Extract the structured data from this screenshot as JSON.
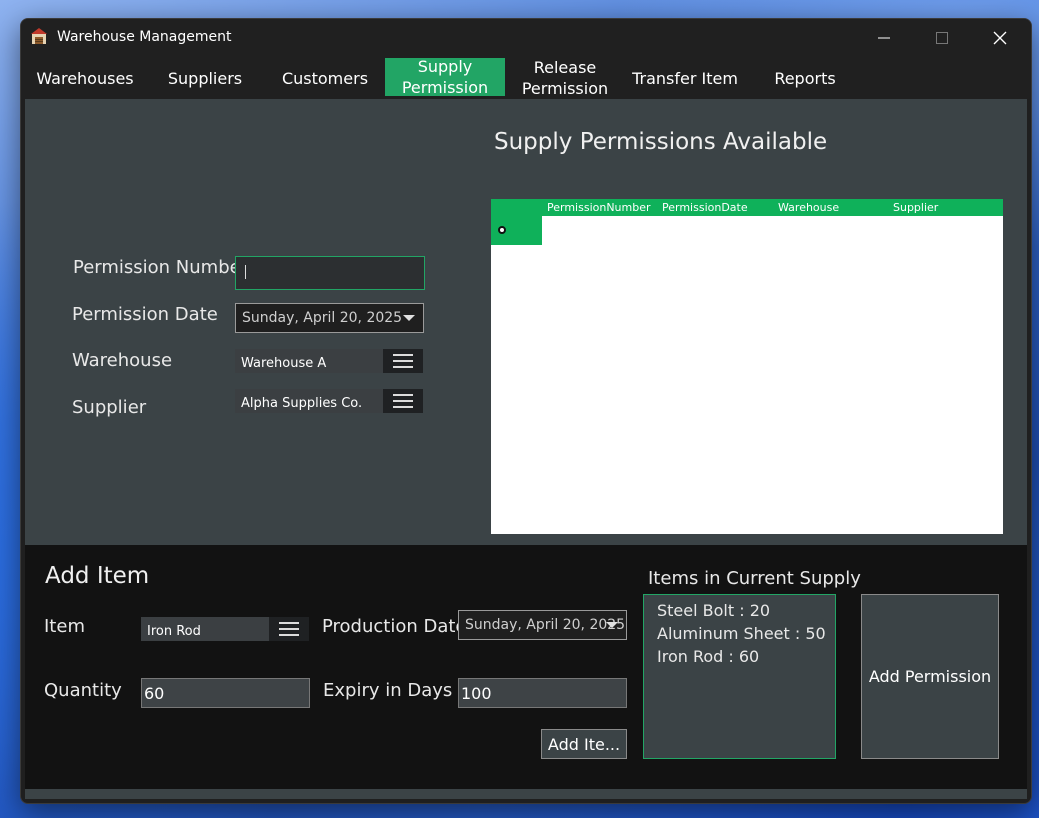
{
  "window": {
    "title": "Warehouse Management"
  },
  "menu": [
    {
      "label": "Warehouses"
    },
    {
      "label": "Suppliers"
    },
    {
      "label": "Customers"
    },
    {
      "label": "Supply\nPermission"
    },
    {
      "label": "Release\nPermission"
    },
    {
      "label": "Transfer Item"
    },
    {
      "label": "Reports"
    }
  ],
  "colors": {
    "accent": "#22a565",
    "panel": "#3b4346",
    "lower_panel": "#121212"
  },
  "permission_form": {
    "permission_number_label": "Permission Number",
    "permission_number_value": "",
    "permission_date_label": "Permission Date",
    "permission_date_value": "Sunday, April 20, 2025",
    "warehouse_label": "Warehouse",
    "warehouse_value": "Warehouse A",
    "supplier_label": "Supplier",
    "supplier_value": "Alpha Supplies Co."
  },
  "permissions_grid": {
    "title": "Supply Permissions Available",
    "columns": [
      "PermissionNumber",
      "PermissionDate",
      "Warehouse",
      "Supplier"
    ],
    "rows": []
  },
  "add_item": {
    "title": "Add Item",
    "item_label": "Item",
    "item_value": "Iron Rod",
    "production_date_label": "Production Date",
    "production_date_value": "Sunday, April 20, 2025",
    "quantity_label": "Quantity",
    "quantity_value": "60",
    "expiry_label": "Expiry in Days",
    "expiry_value": "100",
    "add_item_button": "Add Ite..."
  },
  "current_supply": {
    "title": "Items in Current Supply",
    "items": [
      "Steel Bolt : 20",
      "Aluminum Sheet : 50",
      "Iron Rod : 60"
    ]
  },
  "add_permission_button": "Add Permission"
}
